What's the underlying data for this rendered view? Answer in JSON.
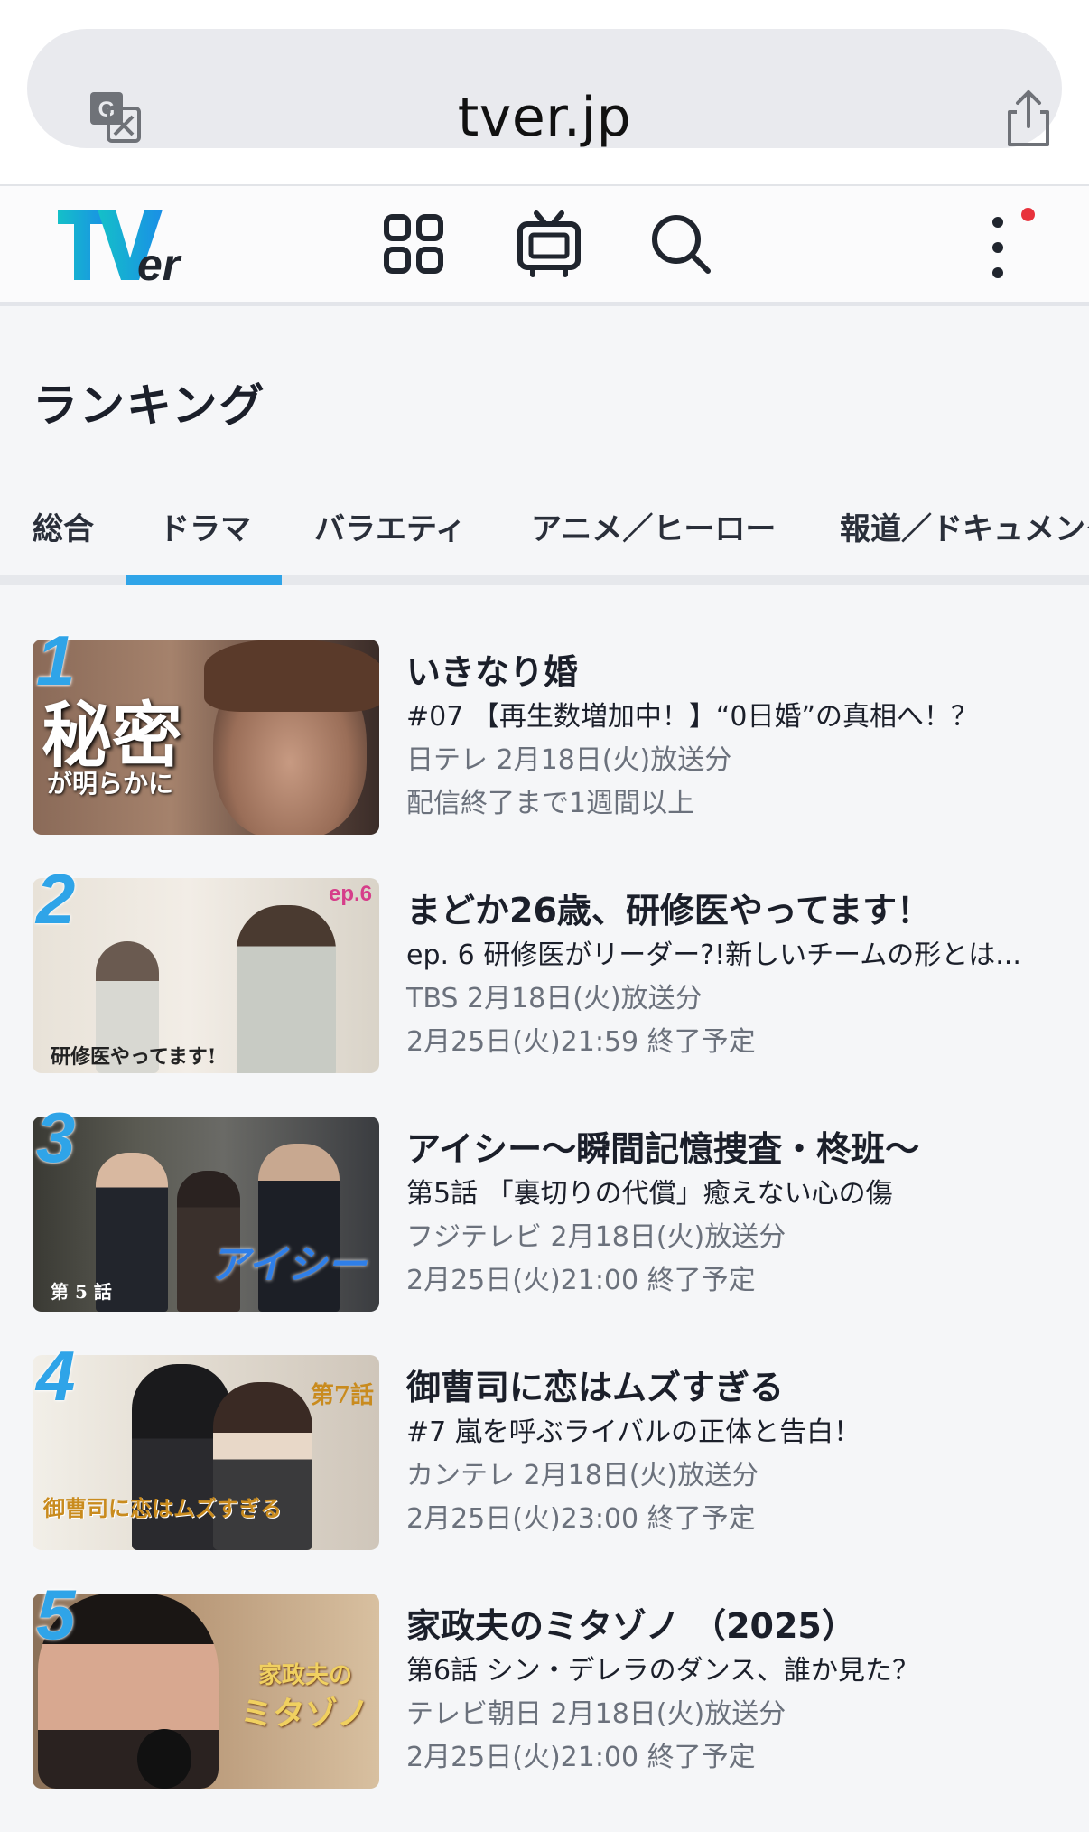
{
  "browser": {
    "url": "tver.jp",
    "translate_icon": "translate-icon",
    "share_icon": "share-icon"
  },
  "header": {
    "logo_text": "TVer",
    "icons": [
      "grid-icon",
      "tv-icon",
      "search-icon",
      "more-vertical-icon"
    ],
    "notification_color": "#e8323c"
  },
  "page": {
    "title": "ランキング"
  },
  "tabs": [
    {
      "label": "総合",
      "active": false
    },
    {
      "label": "ドラマ",
      "active": true
    },
    {
      "label": "バラエティ",
      "active": false
    },
    {
      "label": "アニメ／ヒーロー",
      "active": false
    },
    {
      "label": "報道／ドキュメンタ",
      "active": false
    }
  ],
  "accent_color": "#2fa4e8",
  "ranking": [
    {
      "rank": "1",
      "title": "いきなり婚",
      "episode": "#07 【再生数増加中！】“0日婚”の真相へ！？",
      "broadcast": "日テレ 2月18日(火)放送分",
      "availability": "配信終了まで1週間以上",
      "thumb_caption": "秘密",
      "thumb_subcaption": "が明らかに"
    },
    {
      "rank": "2",
      "title": "まどか26歳、研修医やってます！",
      "episode": "ep. 6 研修医がリーダー?!新しいチームの形とは...",
      "broadcast": "TBS 2月18日(火)放送分",
      "availability": "2月25日(火)21:59 終了予定",
      "thumb_caption": "ep.6",
      "thumb_subcaption": "研修医やってます!"
    },
    {
      "rank": "3",
      "title": "アイシー〜瞬間記憶捜査・柊班〜",
      "episode": "第5話 「裏切りの代償」癒えない心の傷",
      "broadcast": "フジテレビ 2月18日(火)放送分",
      "availability": "2月25日(火)21:00 終了予定",
      "thumb_caption": "第 5 話",
      "thumb_subcaption": "アイシー"
    },
    {
      "rank": "4",
      "title": "御曹司に恋はムズすぎる",
      "episode": "#7 嵐を呼ぶライバルの正体と告白！",
      "broadcast": "カンテレ 2月18日(火)放送分",
      "availability": "2月25日(火)23:00 終了予定",
      "thumb_caption": "第7話",
      "thumb_subcaption": "御曹司に恋はムズすぎる"
    },
    {
      "rank": "5",
      "title": "家政夫のミタゾノ （2025）",
      "episode": "第6話 シン・デレラのダンス、誰か見た？",
      "broadcast": "テレビ朝日 2月18日(火)放送分",
      "availability": "2月25日(火)21:00 終了予定",
      "thumb_caption": "家政夫の",
      "thumb_subcaption": "ミタゾノ"
    }
  ]
}
